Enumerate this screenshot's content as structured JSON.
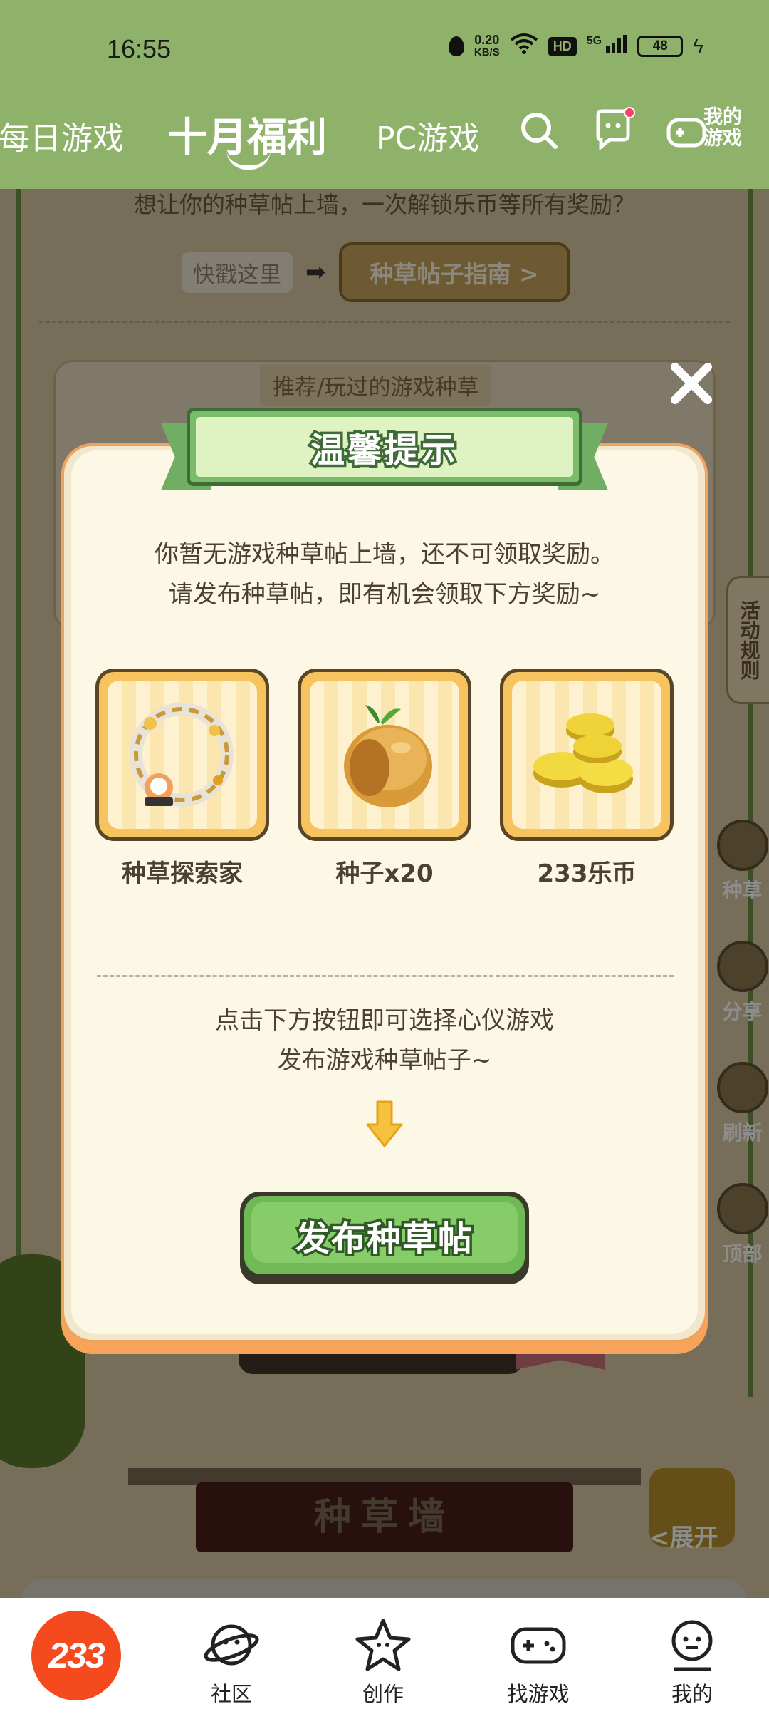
{
  "status_bar": {
    "time": "16:55",
    "net_speed_value": "0.20",
    "net_speed_unit": "KB/S",
    "hd": "HD",
    "signal": "5G",
    "battery": "48"
  },
  "header": {
    "tabs": [
      {
        "label": "每日游戏"
      },
      {
        "label": "十月福利"
      },
      {
        "label": "PC游戏"
      }
    ],
    "active_tab": "十月福利",
    "my_games_line1": "我的",
    "my_games_line2": "游戏",
    "bg_color": "#8fb26a"
  },
  "background_page": {
    "top_message": "想让你的种草帖上墙，一次解锁乐币等所有奖励？",
    "hint_text": "快戳这里",
    "guide_button": "种草帖子指南 >",
    "recommend_tab": "推荐/玩过的游戏种草",
    "rules_tab": "活动规则",
    "side_buttons": [
      "种草",
      "分享",
      "刷新",
      "顶部"
    ],
    "wall_title": "种草墙",
    "expand": "<展开"
  },
  "modal": {
    "title": "温馨提示",
    "message_line1": "你暂无游戏种草帖上墙，还不可领取奖励。",
    "message_line2": "请发布种草帖，即有机会领取下方奖励~",
    "rewards": [
      {
        "label": "种草探索家",
        "icon": "avatar-frame-icon"
      },
      {
        "label": "种子x20",
        "icon": "seed-icon"
      },
      {
        "label": "233乐币",
        "icon": "coins-icon"
      }
    ],
    "instruction_line1": "点击下方按钮即可选择心仪游戏",
    "instruction_line2": "发布游戏种草帖子~",
    "button_label": "发布种草帖",
    "accent_color": "#79bd6a",
    "button_color": "#86cd69"
  },
  "bottom_nav": {
    "logo": "233",
    "items": [
      {
        "label": "社区",
        "icon": "planet-face-icon"
      },
      {
        "label": "创作",
        "icon": "star-icon"
      },
      {
        "label": "找游戏",
        "icon": "gamepad-icon"
      },
      {
        "label": "我的",
        "icon": "profile-face-icon"
      }
    ]
  }
}
